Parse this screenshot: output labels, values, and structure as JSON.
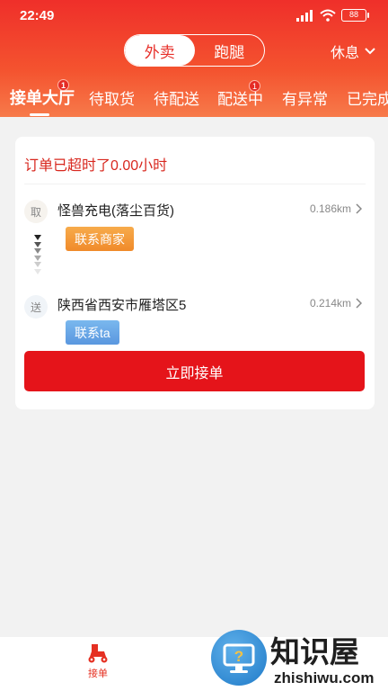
{
  "status_bar": {
    "time": "22:49",
    "battery": "88"
  },
  "header": {
    "segments": [
      {
        "label": "外卖",
        "active": true
      },
      {
        "label": "跑腿",
        "active": false
      }
    ],
    "rest_label": "休息"
  },
  "tabs": [
    {
      "label": "接单大厅",
      "badge": "1",
      "active": true
    },
    {
      "label": "待取货",
      "badge": "",
      "active": false
    },
    {
      "label": "待配送",
      "badge": "",
      "active": false
    },
    {
      "label": "配送中",
      "badge": "1",
      "active": false
    },
    {
      "label": "有异常",
      "badge": "",
      "active": false
    },
    {
      "label": "已完成",
      "badge": "",
      "active": false
    }
  ],
  "order": {
    "overtime_text": "订单已超时了0.00小时",
    "pickup": {
      "tag": "取",
      "name": "怪兽充电(落尘百货)",
      "distance": "0.186km",
      "contact_label": "联系商家"
    },
    "delivery": {
      "tag": "送",
      "name": "陕西省西安市雁塔区5",
      "distance": "0.214km",
      "contact_label": "联系ta"
    },
    "accept_label": "立即接单"
  },
  "bottom_nav": {
    "items": [
      {
        "label": "接单",
        "icon": "scooter-icon",
        "active": true
      }
    ]
  },
  "watermark": {
    "title": "知识屋",
    "url": "zhishiwu.com",
    "icon": "question-monitor-icon"
  },
  "colors": {
    "brand_red": "#e5141a",
    "header_gradient_top": "#ef2f2a",
    "merchant_orange": "#f08a2a",
    "customer_blue": "#5a97df"
  }
}
